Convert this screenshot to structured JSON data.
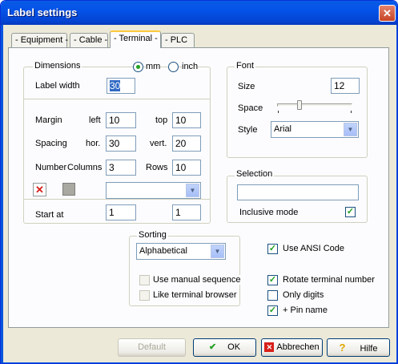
{
  "window": {
    "title": "Label settings",
    "close_glyph": "✕"
  },
  "tabs": [
    {
      "label": "- Equipment -"
    },
    {
      "label": "- Cable -"
    },
    {
      "label": "- Terminal -",
      "active": true
    },
    {
      "label": "- PLC"
    }
  ],
  "dimensions": {
    "group_label": "Dimensions",
    "unit_mm": "mm",
    "unit_inch": "inch",
    "selected_unit": "mm",
    "label_width_label": "Label width",
    "label_width_value": "30",
    "margin_label": "Margin",
    "left_label": "left",
    "left_value": "10",
    "top_label": "top",
    "top_value": "10",
    "spacing_label": "Spacing",
    "hor_label": "hor.",
    "hor_value": "30",
    "vert_label": "vert.",
    "vert_value": "20",
    "number_label": "Number",
    "columns_label": "Columns",
    "columns_value": "3",
    "rows_label": "Rows",
    "rows_value": "10",
    "combo_value": "",
    "start_at_label": "Start at",
    "start_at_1": "1",
    "start_at_2": "1",
    "delete_glyph": "✕"
  },
  "font": {
    "group_label": "Font",
    "size_label": "Size",
    "size_value": "12",
    "space_label": "Space",
    "space_level": 0.3,
    "style_label": "Style",
    "style_value": "Arial"
  },
  "selection": {
    "group_label": "Selection",
    "input_value": "",
    "inclusive_label": "Inclusive mode",
    "inclusive_checked": true
  },
  "sorting": {
    "group_label": "Sorting",
    "value": "Alphabetical",
    "manual_sequence_label": "Use manual sequence",
    "like_browser_label": "Like terminal browser"
  },
  "options": {
    "ansi_label": "Use ANSI Code",
    "rotate_label": "Rotate terminal number",
    "only_digits_label": "Only digits",
    "pin_name_label": "+ Pin name"
  },
  "buttons": {
    "default": "Default",
    "ok": "OK",
    "cancel": "Abbrechen",
    "help": "Hilfe",
    "ok_glyph": "✔",
    "cancel_glyph": "✕",
    "help_glyph": "?"
  },
  "colors": {
    "title_bar": "#0453e8",
    "check": "#21a121",
    "cancel_icon": "#d8201a"
  }
}
